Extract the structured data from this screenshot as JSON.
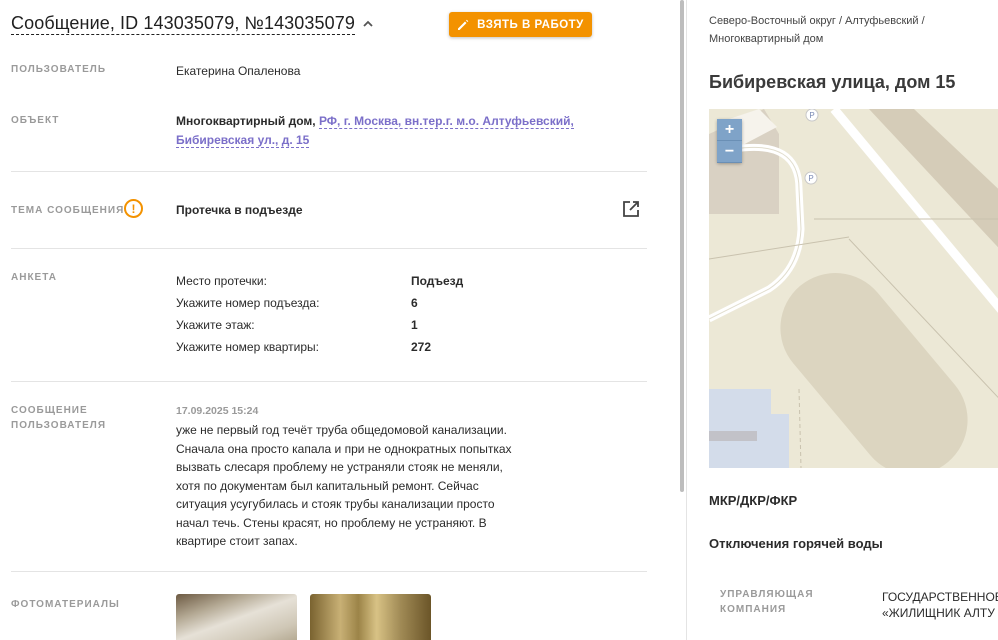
{
  "header": {
    "title": "Сообщение, ID 143035079, №143035079",
    "take_button": "ВЗЯТЬ В РАБОТУ"
  },
  "fields": {
    "user_label": "ПОЛЬЗОВАТЕЛЬ",
    "user_value": "Екатерина Опаленова",
    "object_label": "ОБЪЕКТ",
    "object_type": "Многоквартирный дом,",
    "object_address": "РФ, г. Москва, вн.тер.г. м.о. Алтуфьевский, Бибиревская ул., д. 15",
    "topic_label": "ТЕМА СООБЩЕНИЯ",
    "topic_value": "Протечка в подъезде",
    "anketa_label": "АНКЕТА",
    "message_label_1": "СООБЩЕНИЕ",
    "message_label_2": "ПОЛЬЗОВАТЕЛЯ",
    "photos_label": "ФОТОМАТЕРИАЛЫ"
  },
  "anketa": [
    {
      "q": "Место протечки:",
      "a": "Подъезд"
    },
    {
      "q": "Укажите номер подъезда:",
      "a": "6"
    },
    {
      "q": "Укажите этаж:",
      "a": "1"
    },
    {
      "q": "Укажите номер квартиры:",
      "a": "272"
    }
  ],
  "message": {
    "date": "17.09.2025 15:24",
    "text": "уже не первый год течёт труба общедомовой канализации. Сначала она просто капала и при не однократных попытках вызвать слесаря проблему не устраняли стояк не меняли, хотя по документам был капитальный ремонт. Сейчас ситуация усугубилась и стояк трубы канализации просто начал течь. Стены красят, но проблему не устраняют. В квартире стоит запах."
  },
  "right": {
    "breadcrumb_1": "Северо-Восточный округ / Алтуфьевский /",
    "breadcrumb_2": "Многоквартирный дом",
    "address_title": "Бибиревская улица, дом 15",
    "zoom_in": "+",
    "zoom_out": "−",
    "link_1": "МКР/ДКР/ФКР",
    "link_2": "Отключения горячей воды",
    "mc_label_1": "УПРАВЛЯЮЩАЯ",
    "mc_label_2": "КОМПАНИЯ",
    "mc_value_1": "ГОСУДАРСТВЕННОЕ",
    "mc_value_2": "«ЖИЛИЩНИК АЛТУ"
  },
  "icons": {
    "warning": "warning-icon",
    "external": "external-link-icon",
    "pencil": "pencil-icon",
    "chevron": "chevron-up-icon"
  },
  "colors": {
    "accent": "#f39200",
    "link": "#7b6fc9",
    "label": "#9a9a9a"
  }
}
